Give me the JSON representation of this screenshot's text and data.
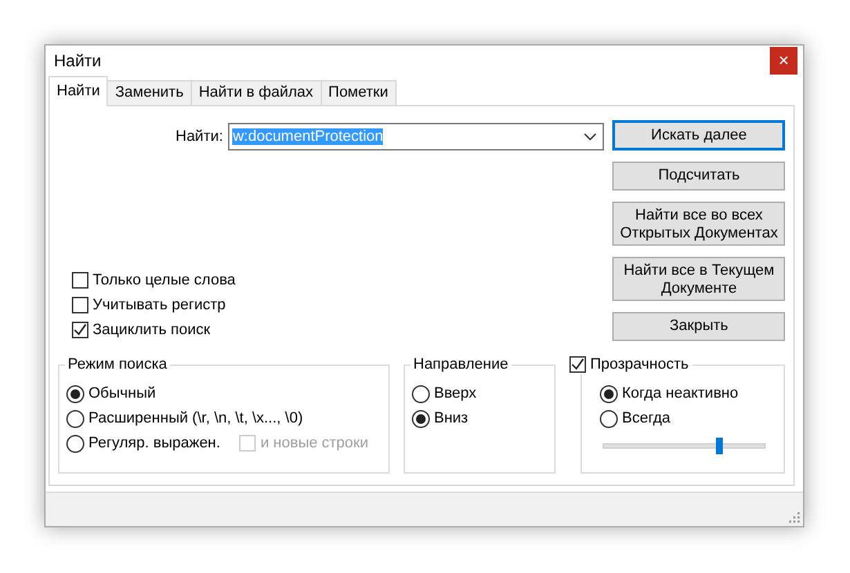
{
  "window": {
    "title": "Найти",
    "close": "×"
  },
  "tabs": [
    {
      "label": "Найти",
      "selected": true
    },
    {
      "label": "Заменить",
      "selected": false
    },
    {
      "label": "Найти в файлах",
      "selected": false
    },
    {
      "label": "Пометки",
      "selected": false
    }
  ],
  "find": {
    "label": "Найти:",
    "value": "w:documentProtection"
  },
  "buttons": [
    {
      "label": "Искать далее",
      "default": true
    },
    {
      "label": "Подсчитать",
      "default": false
    },
    {
      "label": "Найти все во всех Открытых Документах",
      "default": false
    },
    {
      "label": "Найти все в Текущем Документе",
      "default": false
    },
    {
      "label": "Закрыть",
      "default": false
    }
  ],
  "options": [
    {
      "label": "Только целые слова",
      "checked": false
    },
    {
      "label": "Учитывать регистр",
      "checked": false
    },
    {
      "label": "Зациклить поиск",
      "checked": true
    }
  ],
  "search_mode": {
    "title": "Режим поиска",
    "options": [
      {
        "label": "Обычный",
        "selected": true
      },
      {
        "label": "Расширенный (\\r, \\n, \\t, \\x..., \\0)",
        "selected": false
      },
      {
        "label": "Регуляр. выражен.",
        "selected": false
      }
    ],
    "newlines": {
      "label": "и новые строки",
      "checked": false,
      "disabled": true
    }
  },
  "direction": {
    "title": "Направление",
    "options": [
      {
        "label": "Вверх",
        "selected": false
      },
      {
        "label": "Вниз",
        "selected": true
      }
    ]
  },
  "transparency": {
    "label": "Прозрачность",
    "checked": true,
    "options": [
      {
        "label": "Когда неактивно",
        "selected": true
      },
      {
        "label": "Всегда",
        "selected": false
      }
    ],
    "level": 0.71
  }
}
